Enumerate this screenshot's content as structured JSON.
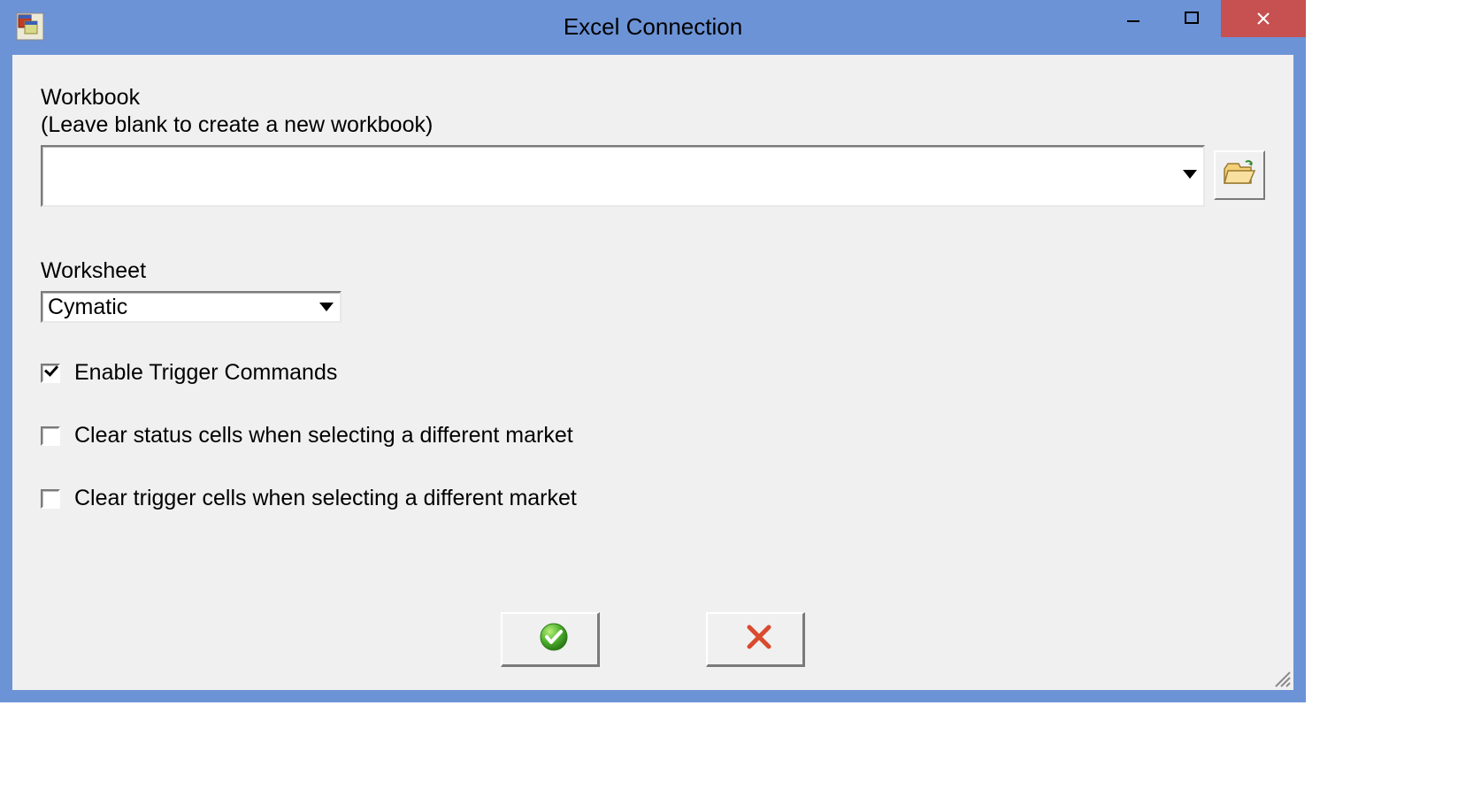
{
  "window": {
    "title": "Excel Connection"
  },
  "workbook": {
    "label": "Workbook",
    "hint": "(Leave blank to create a new workbook)",
    "value": ""
  },
  "worksheet": {
    "label": "Worksheet",
    "value": "Cymatic"
  },
  "options": {
    "enable_trigger": {
      "label": "Enable Trigger Commands",
      "checked": true
    },
    "clear_status": {
      "label": "Clear status cells when selecting a different market",
      "checked": false
    },
    "clear_trigger": {
      "label": "Clear trigger cells when selecting a different market",
      "checked": false
    }
  }
}
